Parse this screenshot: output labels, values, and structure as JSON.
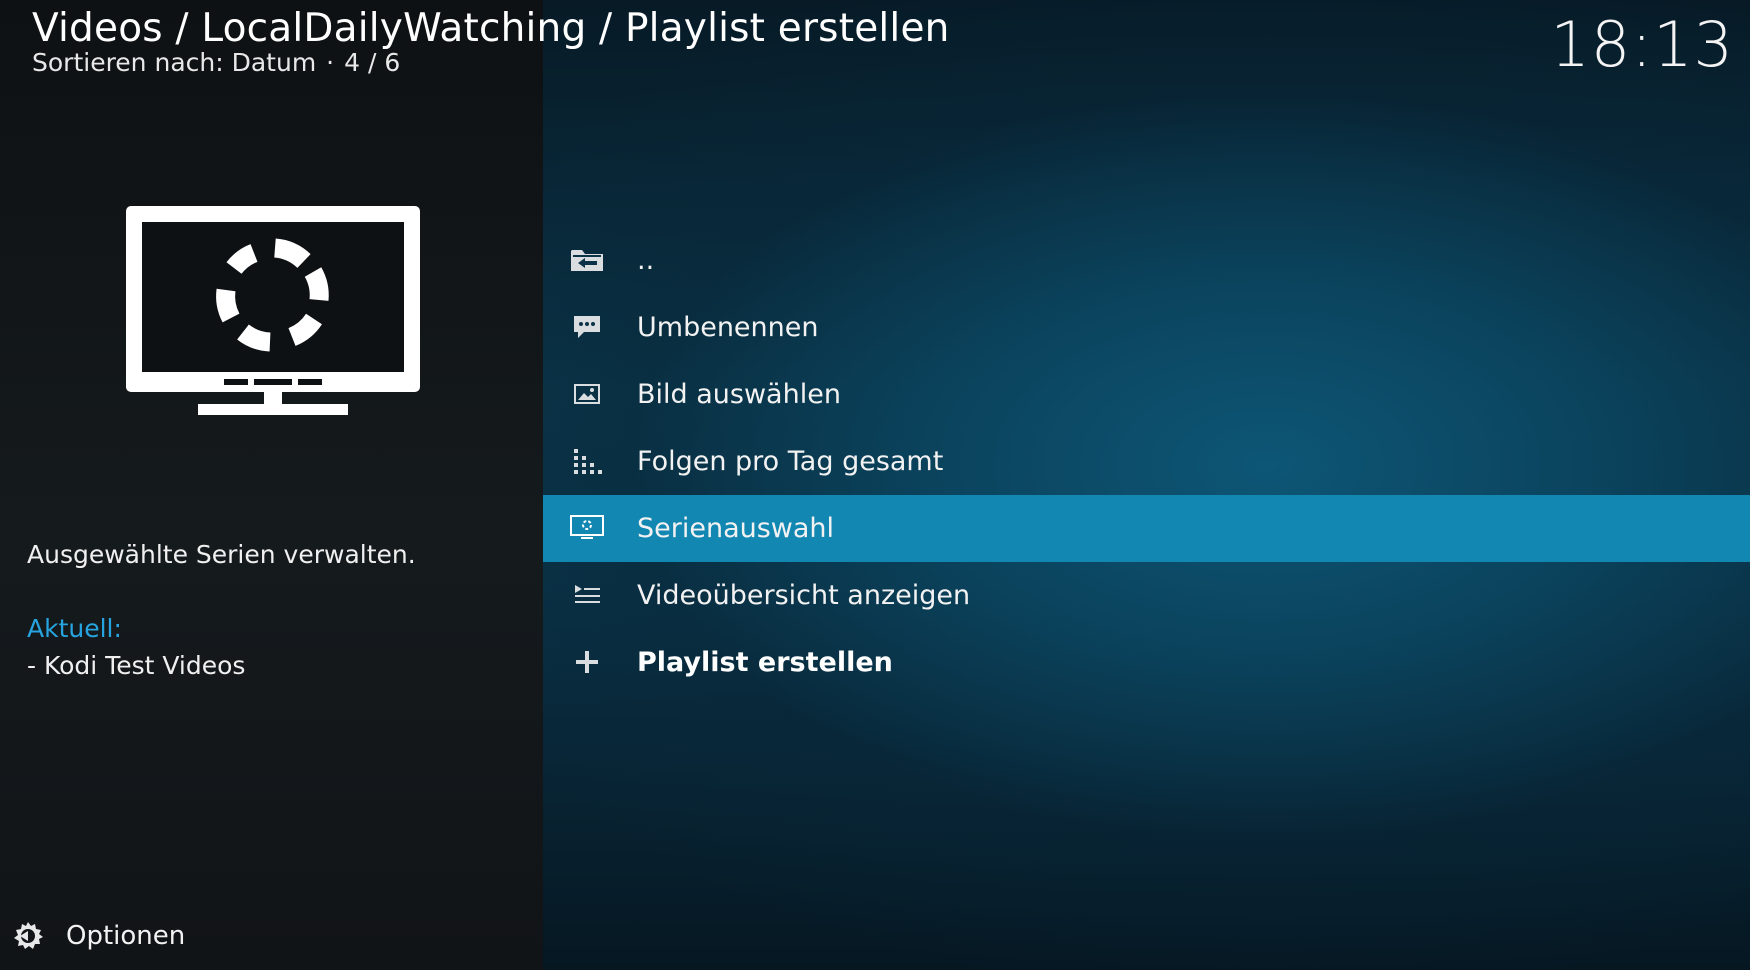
{
  "header": {
    "breadcrumb": "Videos / LocalDailyWatching / Playlist erstellen",
    "sort_label": "Sortieren nach: Datum",
    "position": "4 / 6"
  },
  "clock": "18:13",
  "info": {
    "description": "Ausgewählte Serien verwalten.",
    "current_label": "Aktuell:",
    "current_value": "- Kodi Test Videos"
  },
  "options_label": "Optionen",
  "menu": {
    "items": [
      {
        "label": "..",
        "icon": "folder-back-icon"
      },
      {
        "label": "Umbenennen",
        "icon": "speech-bubble-icon"
      },
      {
        "label": "Bild auswählen",
        "icon": "image-icon"
      },
      {
        "label": "Folgen pro Tag gesamt",
        "icon": "bar-list-icon"
      },
      {
        "label": "Serienauswahl",
        "icon": "tv-icon",
        "selected": true
      },
      {
        "label": "Videoübersicht anzeigen",
        "icon": "playlist-icon"
      },
      {
        "label": "Playlist erstellen",
        "icon": "plus-icon"
      }
    ]
  },
  "colors": {
    "accent": "#27a4e0",
    "selected_bg": "#1287b2",
    "left_bg": "#111417",
    "right_bg": "#0b3f57"
  }
}
